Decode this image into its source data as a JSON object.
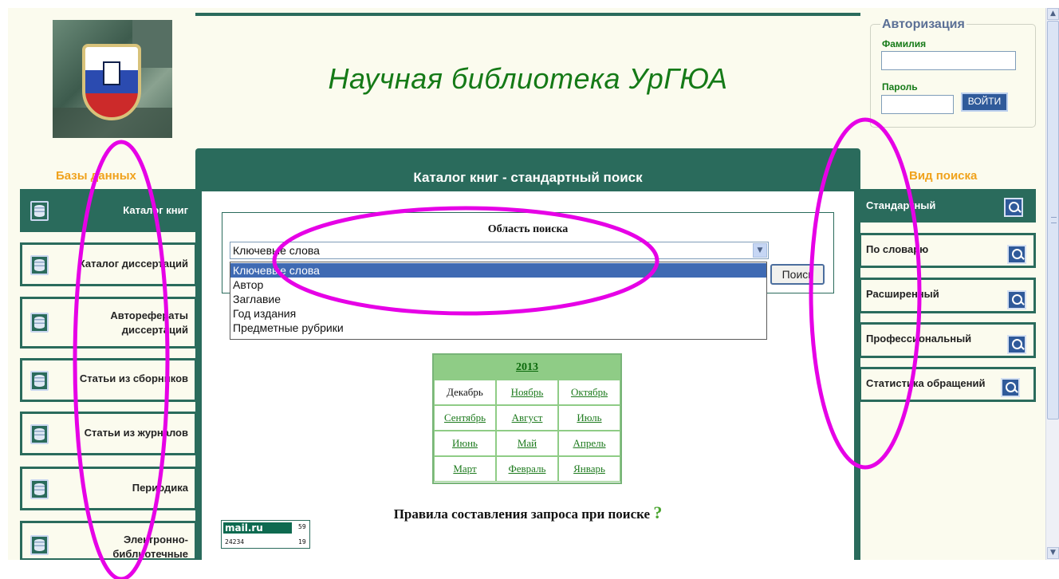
{
  "header": {
    "site_title": "Научная библиотека УрГЮА"
  },
  "auth": {
    "legend": "Авторизация",
    "surname_label": "Фамилия",
    "password_label": "Пароль",
    "login_button": "ВОЙТИ"
  },
  "left": {
    "heading": "Базы данных",
    "items": [
      {
        "label": "Каталог книг"
      },
      {
        "label": "Каталог диссертаций"
      },
      {
        "label": "Авторефераты диссертаций"
      },
      {
        "label": "Статьи из сборников"
      },
      {
        "label": "Статьи из журналов"
      },
      {
        "label": "Периодика"
      },
      {
        "label": "Электронно-библиотечные"
      }
    ]
  },
  "center": {
    "title": "Каталог книг - стандартный поиск",
    "area_label": "Область поиска",
    "selected_value": "Ключевые слова",
    "options": [
      "Ключевые слова",
      "Автор",
      "Заглавие",
      "Год издания",
      "Предметные рубрики"
    ],
    "search_button": "Поиск",
    "calendar": {
      "year": "2013",
      "months": [
        [
          "Декабрь",
          "Ноябрь",
          "Октябрь"
        ],
        [
          "Сентябрь",
          "Август",
          "Июль"
        ],
        [
          "Июнь",
          "Май",
          "Апрель"
        ],
        [
          "Март",
          "Февраль",
          "Январь"
        ]
      ]
    },
    "rules_text": "Правила составления запроса при поиске",
    "rules_mark": "?",
    "counter": {
      "brand": "mail.ru",
      "n1": "59",
      "n2": "24234",
      "n3": "19"
    }
  },
  "right": {
    "heading": "Вид поиска",
    "modes": [
      {
        "label": "Стандартный"
      },
      {
        "label": "По словарю"
      },
      {
        "label": "Расширенный"
      },
      {
        "label": "Профессиональный"
      },
      {
        "label": "Статистика обращений"
      }
    ]
  },
  "colors": {
    "primary_green": "#2a6b5c",
    "title_green": "#157a17",
    "heading_orange": "#f0a21c",
    "annotation_magenta": "#e600e6"
  }
}
